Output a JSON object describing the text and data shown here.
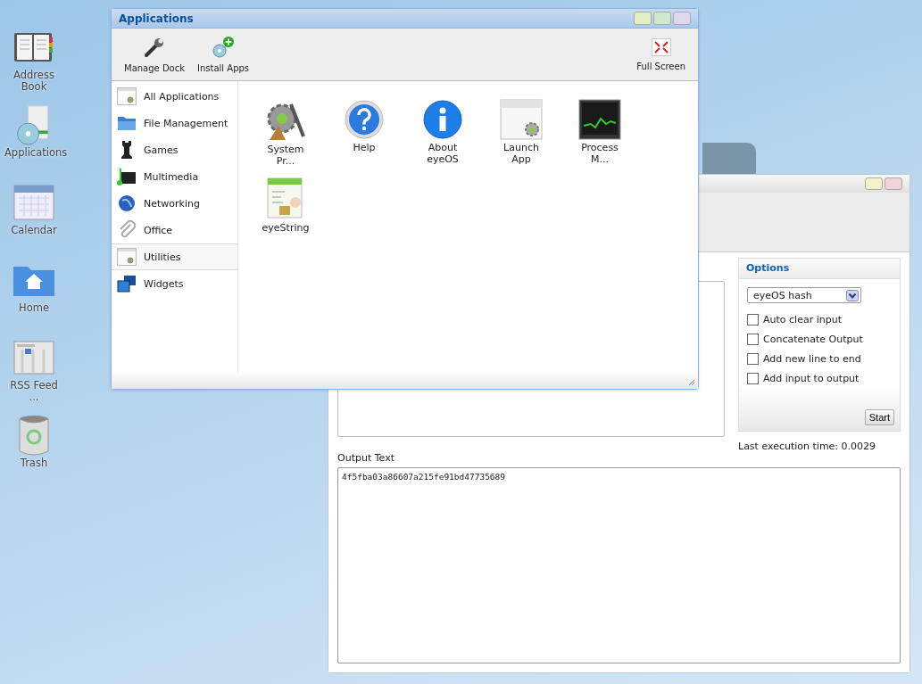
{
  "desktop_icons": [
    {
      "label": "Address Book",
      "kind": "addressbook"
    },
    {
      "label": "Applications",
      "kind": "applications"
    },
    {
      "label": "Calendar",
      "kind": "calendar"
    },
    {
      "label": "Home",
      "kind": "home"
    },
    {
      "label": "RSS Feed ...",
      "kind": "rss"
    },
    {
      "label": "Trash",
      "kind": "trash"
    }
  ],
  "string_window": {
    "options": {
      "title": "Options",
      "hash_select": "eyeOS hash",
      "checkboxes": [
        {
          "label": "Auto clear input",
          "checked": false
        },
        {
          "label": "Concatenate Output",
          "checked": false
        },
        {
          "label": "Add new line to end",
          "checked": false
        },
        {
          "label": "Add input to output",
          "checked": false
        }
      ],
      "start_button": "Start"
    },
    "last_execution": "Last execution time: 0.0029",
    "output_label": "Output Text",
    "output_value": "4f5fba03a86607a215fe91bd47735689"
  },
  "applications_window": {
    "title": "Applications",
    "toolbar": [
      {
        "label": "Manage Dock",
        "kind": "wrench"
      },
      {
        "label": "Install Apps",
        "kind": "install"
      }
    ],
    "full_screen": "Full Screen",
    "categories": [
      {
        "label": "All Applications",
        "kind": "window",
        "selected": false
      },
      {
        "label": "File Management",
        "kind": "folder",
        "selected": false
      },
      {
        "label": "Games",
        "kind": "chess",
        "selected": false
      },
      {
        "label": "Multimedia",
        "kind": "media",
        "selected": false
      },
      {
        "label": "Networking",
        "kind": "globe",
        "selected": false
      },
      {
        "label": "Office",
        "kind": "clip",
        "selected": false
      },
      {
        "label": "Utilities",
        "kind": "window",
        "selected": true
      },
      {
        "label": "Widgets",
        "kind": "widgets",
        "selected": false
      }
    ],
    "apps": [
      {
        "label": "System Pr...",
        "kind": "system"
      },
      {
        "label": "Help",
        "kind": "help"
      },
      {
        "label": "About eyeOS",
        "kind": "about"
      },
      {
        "label": "Launch App",
        "kind": "launch"
      },
      {
        "label": "Process M...",
        "kind": "process"
      },
      {
        "label": "eyeString",
        "kind": "string"
      }
    ]
  }
}
